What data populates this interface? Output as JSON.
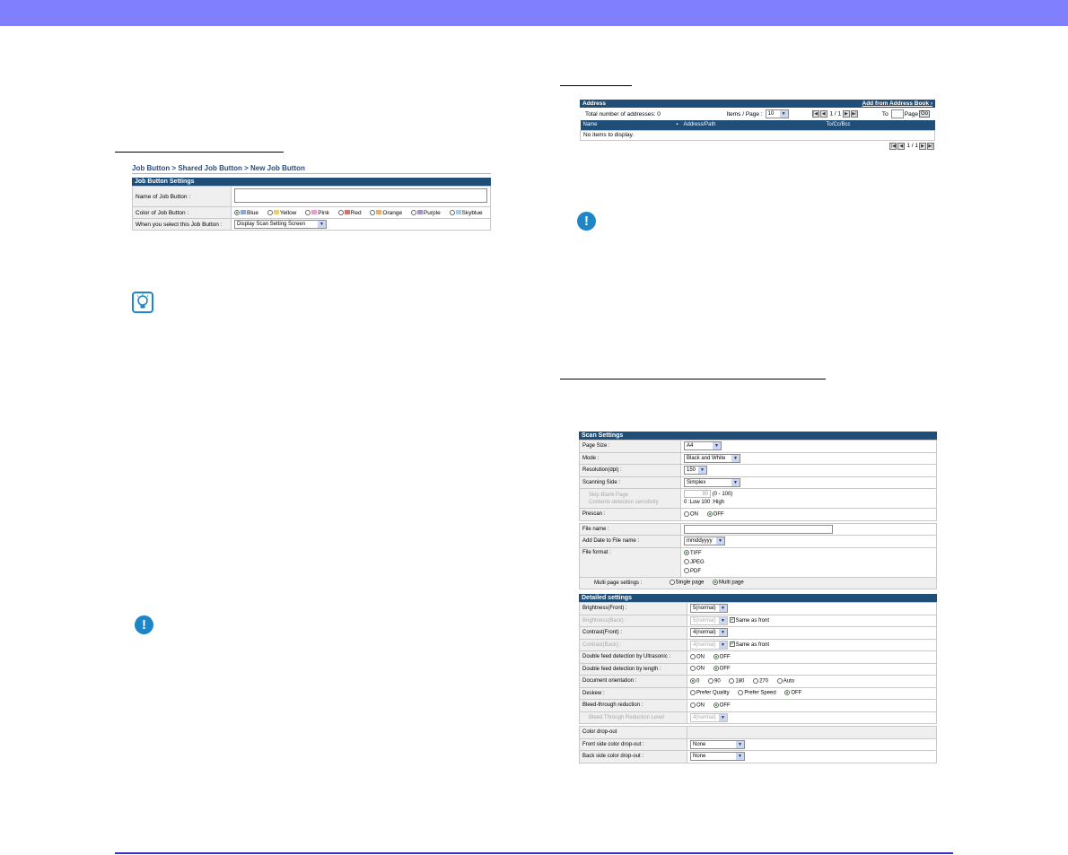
{
  "job_button": {
    "breadcrumb": "Job Button > Shared Job Button > New Job Button",
    "header": "Job Button Settings",
    "name_label": "Name of Job Button :",
    "color_label": "Color of Job Button :",
    "colors": [
      {
        "name": "Blue",
        "swatch": "#8aa8d8",
        "selected": true
      },
      {
        "name": "Yellow",
        "swatch": "#e8d070",
        "selected": false
      },
      {
        "name": "Pink",
        "swatch": "#e8a0c8",
        "selected": false
      },
      {
        "name": "Red",
        "swatch": "#d87070",
        "selected": false
      },
      {
        "name": "Orange",
        "swatch": "#e8b070",
        "selected": false
      },
      {
        "name": "Purple",
        "swatch": "#a890d0",
        "selected": false
      },
      {
        "name": "Skyblue",
        "swatch": "#a8c8e8",
        "selected": false
      }
    ],
    "when_label": "When you select this Job Button :",
    "when_value": "Display Scan Setting Screen"
  },
  "address": {
    "header": "Address",
    "add_link": "Add from Address Book",
    "total": "Total number of addresses: 0",
    "items_per_page_label": "Items / Page :",
    "items_per_page": "10",
    "page_info": "1 / 1",
    "to_label": "To",
    "page_label": "Page",
    "go": "Go",
    "columns": [
      "Name",
      "Address/Path",
      "To/Cc/Bcc"
    ],
    "empty": "No items to display.",
    "footer_page": "1 / 1"
  },
  "scan": {
    "header": "Scan Settings",
    "rows": {
      "page_size": {
        "label": "Page Size :",
        "value": "A4"
      },
      "mode": {
        "label": "Mode :",
        "value": "Black and White"
      },
      "resolution": {
        "label": "Resolution(dpi) :",
        "value": "150"
      },
      "side": {
        "label": "Scanning Side :",
        "value": "Simplex"
      },
      "skip_blank": {
        "label": "Skip Blank Page",
        "label2": "Contents detection sensitivity",
        "value": "90",
        "range": "(0 - 100)",
        "hint": "0 :Low  100 :High"
      },
      "prescan": {
        "label": "Prescan :",
        "on": "ON",
        "off": "OFF"
      },
      "file_name": {
        "label": "File name :"
      },
      "add_date": {
        "label": "Add Date to File name :",
        "value": "mmddyyyy"
      },
      "file_format": {
        "label": "File format :",
        "options": [
          "TIFF",
          "JPEG",
          "PDF"
        ]
      },
      "multipage": {
        "label": "Multi page settings :",
        "single": "Single page",
        "multi": "Multi page"
      }
    }
  },
  "detailed": {
    "header": "Detailed settings",
    "brightness_front": {
      "label": "Brightness(Front) :",
      "value": "5(normal)"
    },
    "brightness_back": {
      "label": "Brightness(Back) :",
      "value": "5(normal)",
      "same": "Same as front"
    },
    "contrast_front": {
      "label": "Contrast(Front) :",
      "value": "4(normal)"
    },
    "contrast_back": {
      "label": "Contrast(Back) :",
      "value": "4(normal)",
      "same": "Same as front"
    },
    "ultrasonic": {
      "label": "Double feed detection by Ultrasonic :",
      "on": "ON",
      "off": "OFF"
    },
    "length": {
      "label": "Double feed detection by length :",
      "on": "ON",
      "off": "OFF"
    },
    "orientation": {
      "label": "Document orientation :",
      "options": [
        "0",
        "90",
        "180",
        "270",
        "Auto"
      ]
    },
    "deskew": {
      "label": "Deskew :",
      "options": [
        "Prefer Quality",
        "Prefer Speed",
        "OFF"
      ]
    },
    "bleed": {
      "label": "Bleed-through reduction :",
      "on": "ON",
      "off": "OFF"
    },
    "bleed_level": {
      "label": "Bleed Through Reduction Level",
      "value": "4(normal)"
    },
    "dropout": {
      "label": "Color drop-out"
    },
    "front_dropout": {
      "label": "Front side color drop-out :",
      "value": "None"
    },
    "back_dropout": {
      "label": "Back side color drop-out :",
      "value": "None"
    }
  }
}
